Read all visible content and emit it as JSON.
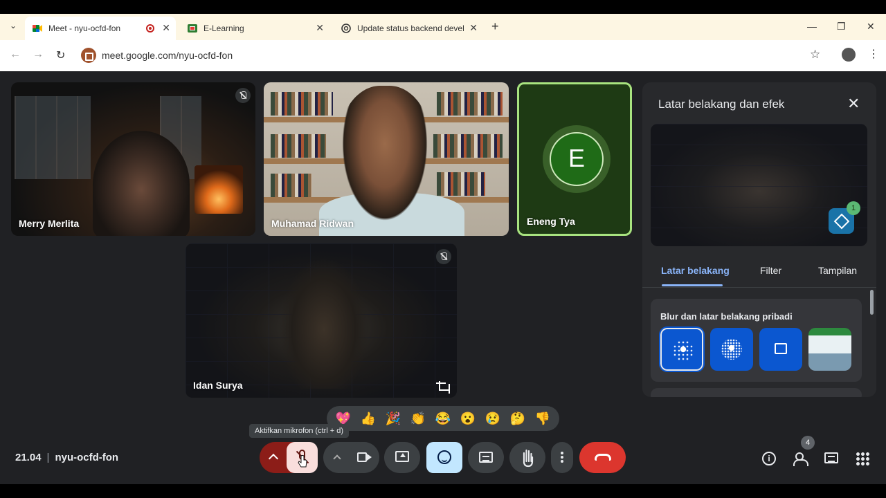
{
  "browser": {
    "tabs": [
      {
        "title": "Meet - nyu-ocfd-fon",
        "icon": "google-meet-icon",
        "active": true,
        "recording": true
      },
      {
        "title": "E-Learning",
        "icon": "elearning-favicon",
        "active": false
      },
      {
        "title": "Update status backend develop",
        "icon": "chatgpt-icon",
        "active": false
      }
    ],
    "url": "meet.google.com/nyu-ocfd-fon"
  },
  "participants": [
    {
      "name": "Merry Merlita",
      "muted": true
    },
    {
      "name": "Muhamad Ridwan",
      "muted": false
    },
    {
      "name": "Eneng Tya",
      "avatar_letter": "E",
      "speaking": true
    },
    {
      "name": "Idan Surya",
      "muted": true
    }
  ],
  "side_panel": {
    "title": "Latar belakang dan efek",
    "effects_count": "1",
    "tabs": [
      "Latar belakang",
      "Filter",
      "Tampilan"
    ],
    "active_tab": "Latar belakang",
    "section_title": "Blur dan latar belakang pribadi",
    "options": [
      "blur-slight-icon",
      "blur-full-icon",
      "upload-background-icon",
      "background-image-thumbnail"
    ]
  },
  "reactions": [
    "💖",
    "👍",
    "🎉",
    "👏",
    "😂",
    "😮",
    "😢",
    "🤔",
    "👎"
  ],
  "tooltip": "Aktifkan mikrofon (ctrl + d)",
  "meeting": {
    "time": "21.04",
    "code": "nyu-ocfd-fon"
  },
  "people_count": "4",
  "colors": {
    "accent": "#8ab4f8",
    "end_call": "#dc362e",
    "mic_off": "#8c1d18",
    "speaking_border": "#a8e37f"
  }
}
